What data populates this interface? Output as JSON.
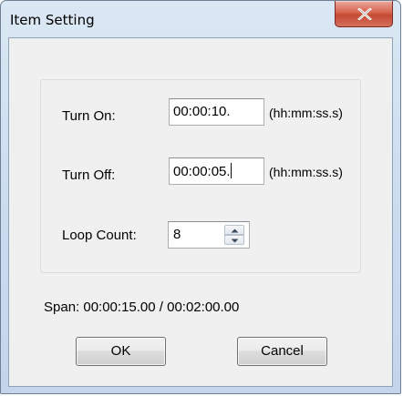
{
  "window": {
    "title": "Item Setting"
  },
  "form": {
    "turn_on": {
      "label": "Turn On:",
      "value": "00:00:10.",
      "hint": "(hh:mm:ss.s)"
    },
    "turn_off": {
      "label": "Turn Off:",
      "value": "00:00:05.",
      "hint": "(hh:mm:ss.s)"
    },
    "loop_count": {
      "label": "Loop Count:",
      "value": "8"
    }
  },
  "span": {
    "text": "Span: 00:00:15.00 / 00:02:00.00"
  },
  "buttons": {
    "ok": "OK",
    "cancel": "Cancel"
  },
  "icons": {
    "close": "close-icon",
    "spin_up": "arrow-up-icon",
    "spin_down": "arrow-down-icon"
  }
}
